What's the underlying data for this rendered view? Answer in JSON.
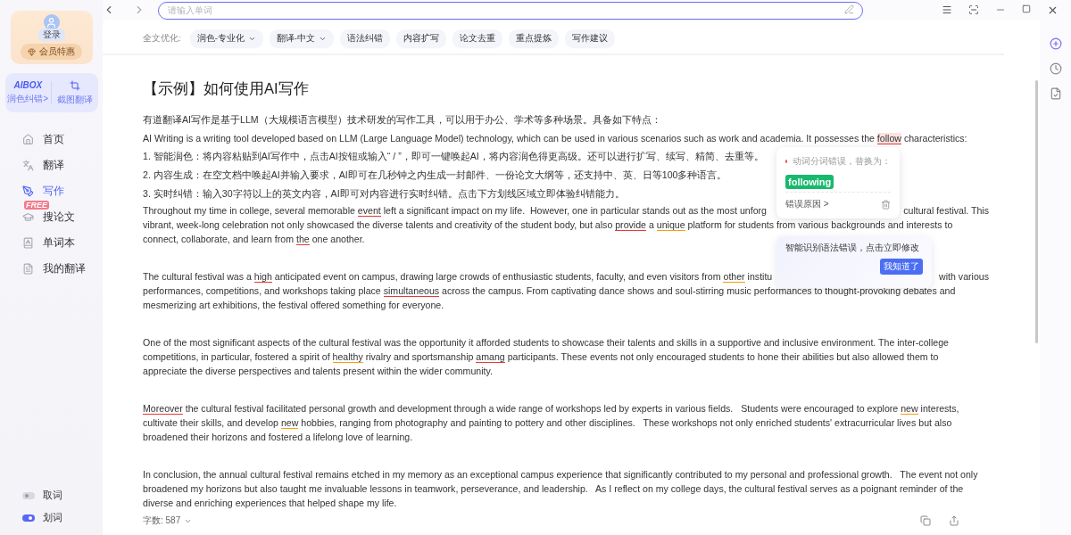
{
  "sidebar": {
    "login_label": "登录",
    "member_label": "会员特惠",
    "aibox": {
      "logo": "AIBOX",
      "polish_link": "润色纠错>",
      "screenshot_label": "截图翻译"
    },
    "nav": [
      {
        "label": "首页",
        "selected": false
      },
      {
        "label": "翻译",
        "selected": false
      },
      {
        "label": "写作",
        "selected": true
      },
      {
        "label": "搜论文",
        "selected": false,
        "badge": "FREE"
      },
      {
        "label": "单词本",
        "selected": false
      },
      {
        "label": "我的翻译",
        "selected": false
      }
    ],
    "toggles": [
      {
        "label": "取词",
        "on": false
      },
      {
        "label": "划词",
        "on": true
      }
    ]
  },
  "search": {
    "placeholder": "请输入单词"
  },
  "toolbar": {
    "label": "全文优化:",
    "chips": [
      {
        "label": "润色-专业化",
        "has_menu": true
      },
      {
        "label": "翻译-中文",
        "has_menu": true
      },
      {
        "label": "语法纠错",
        "has_menu": false
      },
      {
        "label": "内容扩写",
        "has_menu": false
      },
      {
        "label": "论文去重",
        "has_menu": false
      },
      {
        "label": "重点提炼",
        "has_menu": false
      },
      {
        "label": "写作建议",
        "has_menu": false
      }
    ]
  },
  "document": {
    "title": "【示例】如何使用AI写作",
    "intro": [
      [
        {
          "text": "有道翻译AI写作是基于LLM（大规模语言模型）技术研发的写作工具，可以用于办公、学术等多种场景。具备如下特点："
        }
      ],
      [
        {
          "text": "AI Writing is a writing tool developed based on LLM (Large Language Model) technology, which can be used in various scenarios such as work and academia. It possesses the "
        },
        {
          "text": "follow",
          "color": "#e53935",
          "selected": true
        },
        {
          "text": " characteristics:"
        }
      ],
      [
        {
          "text": "1. 智能润色：将内容粘贴到AI写作中，点击AI按钮或输入“ / ”，即可一键唤起AI，将内容润色得更高级。还可以进行扩写、续写、精简、去重等。"
        }
      ],
      [
        {
          "text": "2. 内容生成：在空文档中唤起AI并输入要求，AI即可在几秒钟之内生成一封邮件、一份论文大纲等，还支持中、英、日等100多种语言。"
        }
      ],
      [
        {
          "text": "3. 实时纠错：输入30字符以上的英文内容，AI即可对内容进行实时纠错。点击下方划线区域立即体验纠错能力。"
        }
      ]
    ],
    "paragraphs": [
      {
        "lines": [
          {
            "parts": [
              [
                {
                  "text": "Throughout my time in college, several memorable "
                },
                {
                  "text": "event",
                  "color": "#e53935"
                },
                {
                  "text": " left a significant impact on my life.  However, one in particular stands out as the most unforg"
                }
              ],
              [
                {
                  "text": "cultural festival. This"
                }
              ]
            ]
          },
          {
            "parts": [
              [
                {
                  "text": "vibrant, week-long celebration not only showcased the diverse talents and creativity of the student body, but also "
                },
                {
                  "text": "provide",
                  "color": "#e53935"
                },
                {
                  "text": " a "
                },
                {
                  "text": "unique",
                  "color": "#f59e0b"
                },
                {
                  "text": " platform for students from various backgrounds and interests to"
                }
              ]
            ]
          },
          {
            "parts": [
              [
                {
                  "text": "connect, collaborate, and learn from "
                },
                {
                  "text": "the",
                  "color": "#e53935"
                },
                {
                  "text": " one another."
                }
              ]
            ]
          }
        ]
      },
      {
        "lines": [
          {
            "parts": [
              [
                {
                  "text": "The cultural festival was a "
                },
                {
                  "text": "high",
                  "color": "#e53935"
                },
                {
                  "text": " anticipated event on campus, drawing large crowds of enthusiastic students, faculty, and even visitors from "
                },
                {
                  "text": "other",
                  "color": "#f59e0b"
                },
                {
                  "text": " institu"
                }
              ],
              [
                {
                  "text": "with various"
                }
              ]
            ]
          },
          {
            "parts": [
              [
                {
                  "text": "performances, competitions, and workshops taking place "
                },
                {
                  "text": "simultaneous",
                  "color": "#e53935"
                },
                {
                  "text": " across the campus. From captivating dance shows and soul-stirring music performances to thought-provoking debates and"
                }
              ]
            ]
          },
          {
            "parts": [
              [
                {
                  "text": "mesmerizing art exhibitions, the festival offered something for everyone."
                }
              ]
            ]
          }
        ]
      },
      {
        "lines": [
          {
            "parts": [
              [
                {
                  "text": "One of the most significant aspects of the cultural festival was the opportunity it afforded students to showcase their talents and skills in a supportive and inclusive environment. The inter-college"
                }
              ]
            ]
          },
          {
            "parts": [
              [
                {
                  "text": "competitions, in particular, fostered a spirit of "
                },
                {
                  "text": "healthy",
                  "color": "#f59e0b"
                },
                {
                  "text": " rivalry and sportsmanship "
                },
                {
                  "text": "amang",
                  "color": "#e53935"
                },
                {
                  "text": " participants. These events not only encouraged students to hone their abilities but also allowed them to"
                }
              ]
            ]
          },
          {
            "parts": [
              [
                {
                  "text": "appreciate the diverse perspectives and talents present within the wider community."
                }
              ]
            ]
          }
        ]
      },
      {
        "lines": [
          {
            "parts": [
              [
                {
                  "text": "Moreover",
                  "color": "#e53935"
                },
                {
                  "text": " the cultural festival facilitated personal growth and development through a wide range of workshops led by experts in various fields.   Students were encouraged to explore "
                },
                {
                  "text": "new",
                  "color": "#f59e0b"
                },
                {
                  "text": " interests,"
                }
              ]
            ]
          },
          {
            "parts": [
              [
                {
                  "text": "cultivate their skills, and develop "
                },
                {
                  "text": "new",
                  "color": "#f59e0b"
                },
                {
                  "text": " hobbies, ranging from photography and painting to pottery and other disciplines.   These workshops not only enriched students' extracurricular lives but also"
                }
              ]
            ]
          },
          {
            "parts": [
              [
                {
                  "text": "broadened their horizons and fostered a lifelong love of learning."
                }
              ]
            ]
          }
        ]
      },
      {
        "lines": [
          {
            "parts": [
              [
                {
                  "text": "In conclusion, the annual cultural festival remains etched in my memory as an exceptional campus experience that significantly contributed to my personal and professional growth.   The event not only"
                }
              ]
            ]
          },
          {
            "parts": [
              [
                {
                  "text": "broadened my horizons but also taught me invaluable lessons in teamwork, perseverance, and leadership.   As I reflect on my college days, the cultural festival serves as a poignant reminder of the"
                }
              ]
            ]
          },
          {
            "parts": [
              [
                {
                  "text": "diverse and enriching experiences that helped shape my life."
                }
              ]
            ]
          }
        ]
      }
    ]
  },
  "suggestion_popover": {
    "error_label": "动词分词错误，替换为：",
    "replacement": "following",
    "reason_link": "错误原因 >"
  },
  "tip_popover": {
    "message": "智能识别语法错误，点击立即修改",
    "button": "我知道了"
  },
  "footer": {
    "word_count": "字数: 587"
  }
}
